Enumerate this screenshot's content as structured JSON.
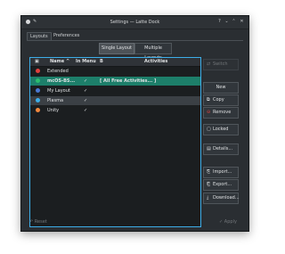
{
  "window": {
    "title": "Settings — Latte Dock",
    "controls": {
      "help": "?",
      "minimize": "⌄",
      "maximize": "⌃",
      "close": "✕"
    }
  },
  "tabs": [
    "Layouts",
    "Preferences"
  ],
  "layout_mode": {
    "single": "Single Layout",
    "multiple": "Multiple Layouts"
  },
  "table": {
    "headers": {
      "name": "Name",
      "sort_indicator": "^",
      "in_menu": "In Menu",
      "activities_icon": "B",
      "activities": "Activities"
    },
    "rows": [
      {
        "name": "Extended",
        "in_menu": "",
        "activities": "",
        "color": "#e0403d"
      },
      {
        "name": "mcOS-BS...",
        "in_menu": "✓",
        "activities": "[ All Free Activities... ]",
        "color": "#2bbd6e"
      },
      {
        "name": "My Layout",
        "in_menu": "✓",
        "activities": "",
        "color": "#4a78d0"
      },
      {
        "name": "Plasma",
        "in_menu": "✓",
        "activities": "",
        "color": "#3daee9"
      },
      {
        "name": "Unity",
        "in_menu": "✓",
        "activities": "",
        "color": "#f0883e"
      }
    ]
  },
  "side_buttons": {
    "switch": "Switch",
    "new": "New",
    "copy": "Copy",
    "remove": "Remove",
    "locked": "Locked",
    "details": "Details...",
    "import": "Import...",
    "export": "Export...",
    "download": "Download..."
  },
  "footer": {
    "reset": "Reset",
    "apply": "Apply"
  },
  "colors": {
    "accent": "#3daee9",
    "selection": "#1d7f6a",
    "window_bg": "#2a2e32"
  }
}
